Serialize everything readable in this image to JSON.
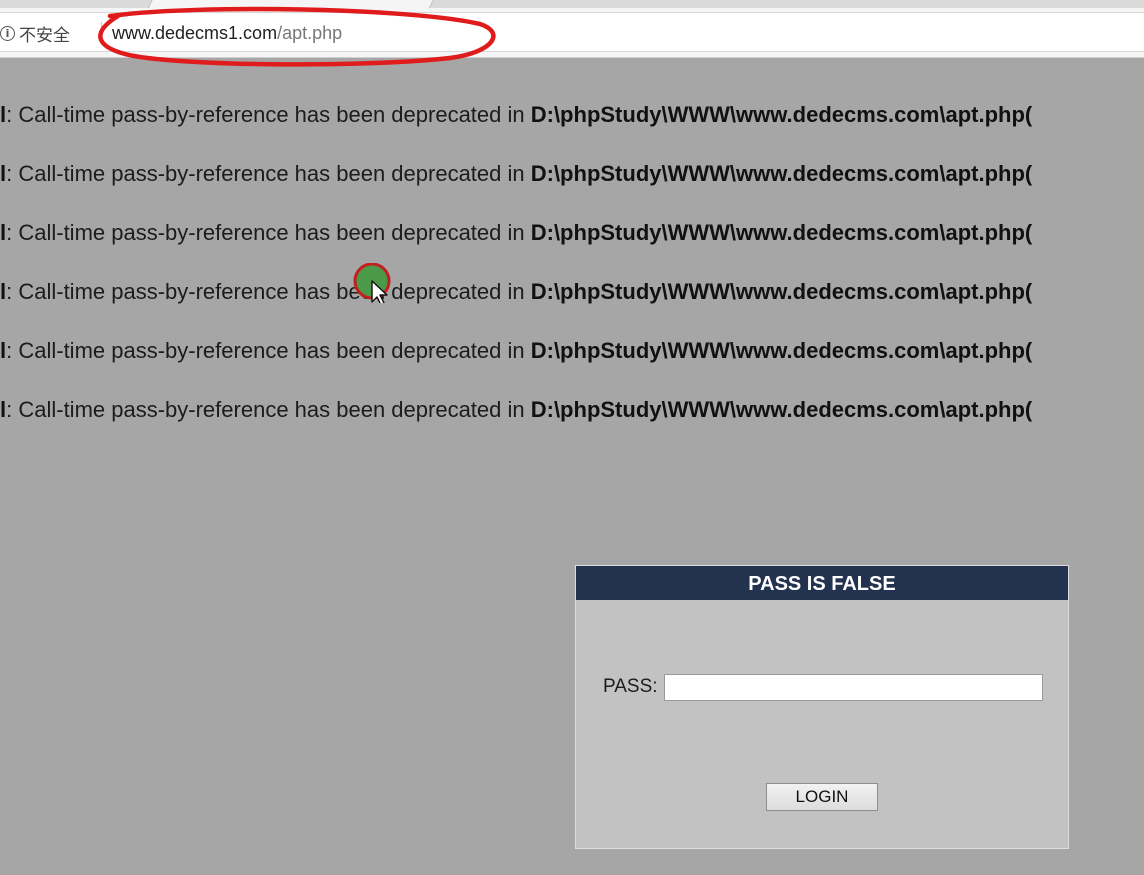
{
  "browser": {
    "security_label": "不安全",
    "url_host": "www.dedecms1.com",
    "url_path": "/apt.php",
    "annotation_color": "#e01b1b"
  },
  "warnings": [
    {
      "prefix": "l",
      "message": ": Call-time pass-by-reference has been deprecated in ",
      "path": "D:\\phpStudy\\WWW\\www.dedecms.com\\apt.php("
    },
    {
      "prefix": "l",
      "message": ": Call-time pass-by-reference has been deprecated in ",
      "path": "D:\\phpStudy\\WWW\\www.dedecms.com\\apt.php("
    },
    {
      "prefix": "l",
      "message": ": Call-time pass-by-reference has been deprecated in ",
      "path": "D:\\phpStudy\\WWW\\www.dedecms.com\\apt.php("
    },
    {
      "prefix": "l",
      "message": ": Call-time pass-by-reference has been deprecated in ",
      "path": "D:\\phpStudy\\WWW\\www.dedecms.com\\apt.php("
    },
    {
      "prefix": "l",
      "message": ": Call-time pass-by-reference has been deprecated in ",
      "path": "D:\\phpStudy\\WWW\\www.dedecms.com\\apt.php("
    },
    {
      "prefix": "l",
      "message": ": Call-time pass-by-reference has been deprecated in ",
      "path": "D:\\phpStudy\\WWW\\www.dedecms.com\\apt.php("
    }
  ],
  "login_panel": {
    "title": "PASS IS FALSE",
    "pass_label": "PASS:",
    "pass_value": "",
    "login_label": "LOGIN",
    "header_color": "#23324f"
  },
  "cursor": {
    "icon": "arrow-cursor-icon",
    "click_indicator_color": "#4a9a4a"
  }
}
